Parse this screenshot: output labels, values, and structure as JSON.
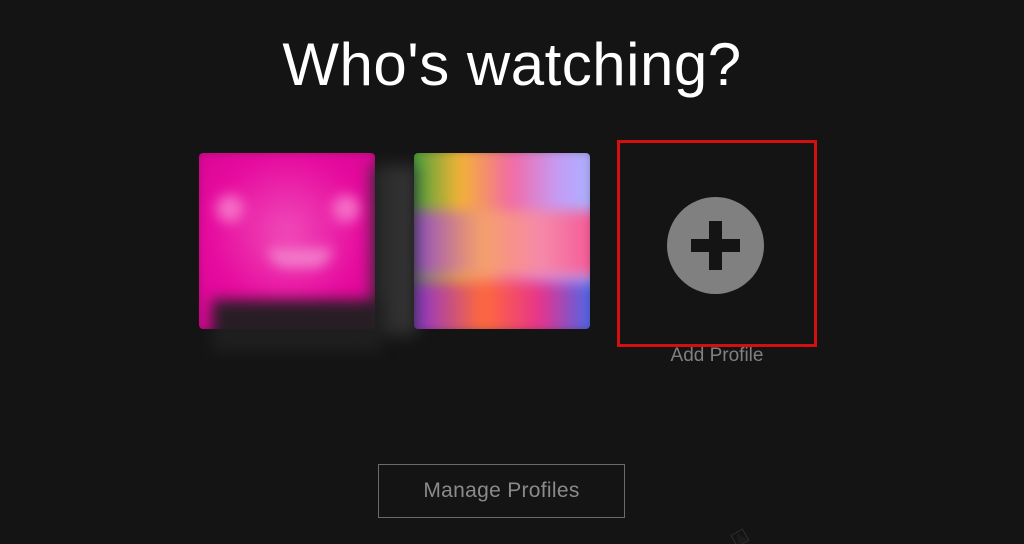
{
  "page_title": "Who's watching?",
  "profiles": [
    {
      "name": "",
      "icon": "profile-avatar-pink"
    },
    {
      "name": "",
      "icon": "profile-avatar-colorful"
    }
  ],
  "add_profile": {
    "label": "Add Profile",
    "icon": "plus-circle-icon",
    "highlight_color": "#d40f0f"
  },
  "manage_profiles_label": "Manage Profiles",
  "colors": {
    "background": "#141414",
    "title": "#ffffff",
    "muted_text": "#808080"
  }
}
